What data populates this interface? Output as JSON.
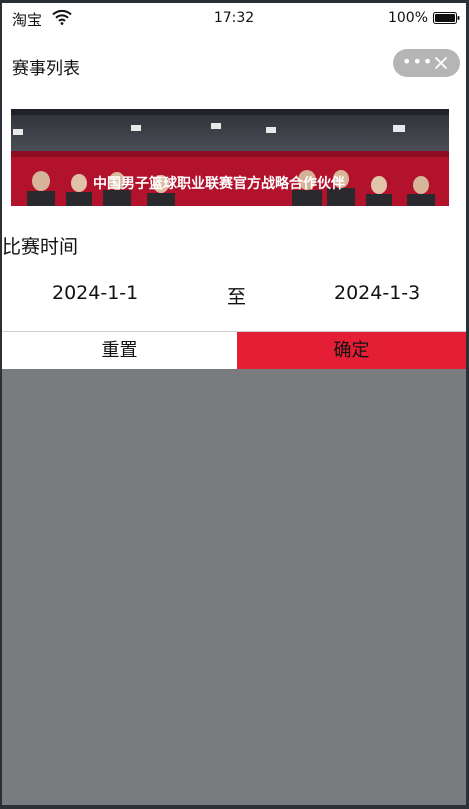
{
  "status_bar": {
    "carrier": "淘宝",
    "time": "17:32",
    "battery": "100%"
  },
  "nav": {
    "title": "赛事列表",
    "more_icon": "more-dots-icon",
    "close_icon": "close-icon"
  },
  "banner": {
    "caption": "中国男子篮球职业联赛官方战略合作伙伴"
  },
  "filter": {
    "section_label": "比赛时间",
    "start_date": "2024-1-1",
    "separator": "至",
    "end_date": "2024-1-3"
  },
  "actions": {
    "reset_label": "重置",
    "confirm_label": "确定",
    "confirm_color": "#e31e35"
  }
}
